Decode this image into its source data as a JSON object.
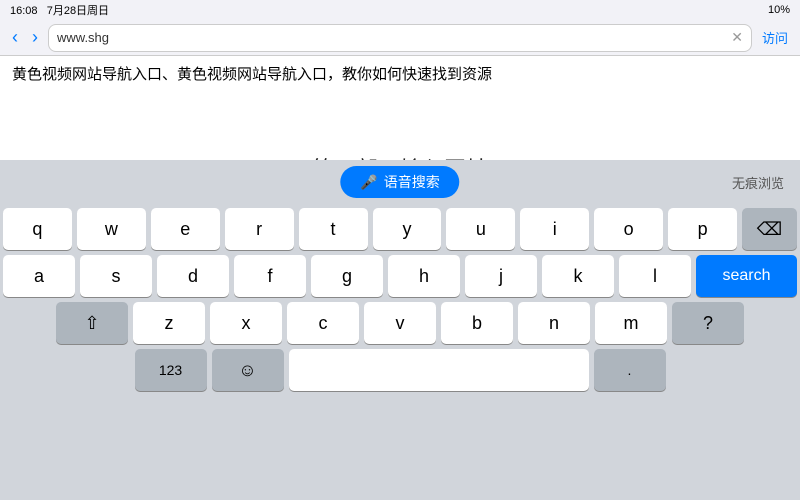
{
  "statusBar": {
    "time": "16:08",
    "date": "7月28日周日",
    "battery": "10%"
  },
  "browserChrome": {
    "backIcon": "‹",
    "forwardIcon": "›",
    "urlText": "www.shg",
    "clearIcon": "✕",
    "visitLabel": "访问"
  },
  "pageContent": {
    "text": "黄色视频网站导航入口、黄色视频网站导航入口，教你如何快速找到资源"
  },
  "sectionHeading": {
    "text": "第四部，输入网址"
  },
  "keyboardTopBar": {
    "voiceSearchLabel": "语音搜索",
    "privateLabel": "无痕浏览"
  },
  "keyboard": {
    "row1": [
      "q",
      "w",
      "e",
      "r",
      "t",
      "y",
      "u",
      "i",
      "o",
      "p"
    ],
    "row2": [
      "a",
      "s",
      "d",
      "f",
      "g",
      "h",
      "j",
      "k",
      "l"
    ],
    "row3": [
      "z",
      "x",
      "c",
      "v",
      "b",
      "n",
      "m"
    ],
    "row4Space": "space",
    "searchLabel": "search",
    "deleteIcon": "⌫",
    "shiftIcon": "⇧",
    "numbersLabel": "123",
    "emojiIcon": "☺",
    "periodLabel": ".",
    "questionLabel": "?"
  }
}
